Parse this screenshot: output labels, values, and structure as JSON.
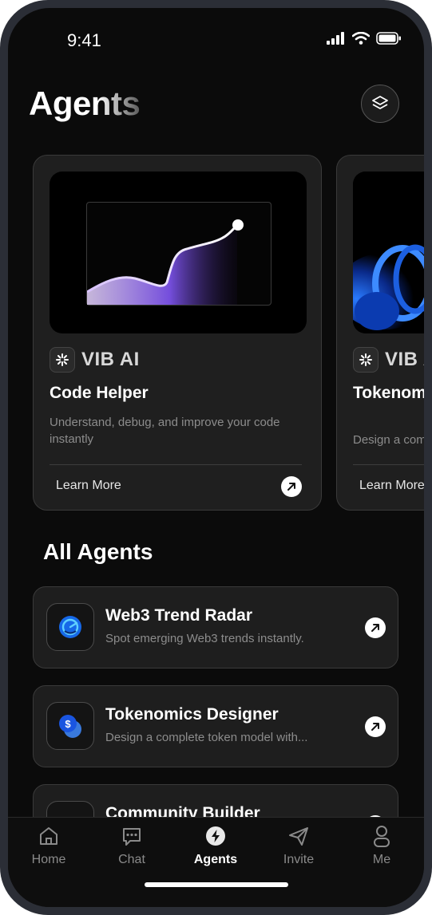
{
  "status": {
    "time": "9:41"
  },
  "header": {
    "title": "Agents",
    "layers_icon": "layers-icon"
  },
  "featured": [
    {
      "brand": "VIB AI",
      "title": "Code Helper",
      "description": "Understand, debug, and improve your code instantly",
      "action": "Learn More"
    },
    {
      "brand": "VIB AI",
      "title": "Tokenomics Designer",
      "description": "Design a complete token model with...",
      "action": "Learn More"
    }
  ],
  "section": {
    "title": "All Agents"
  },
  "agents": [
    {
      "name": "Web3 Trend Radar",
      "description": "Spot emerging Web3 trends instantly.",
      "icon": "radar-icon"
    },
    {
      "name": "Tokenomics Designer",
      "description": "Design a complete token model with...",
      "icon": "token-icon"
    },
    {
      "name": "Community Builder",
      "description": "",
      "icon": "community-icon"
    }
  ],
  "tabs": [
    {
      "label": "Home",
      "icon": "home-icon",
      "active": false
    },
    {
      "label": "Chat",
      "icon": "chat-icon",
      "active": false
    },
    {
      "label": "Agents",
      "icon": "bolt-icon",
      "active": true
    },
    {
      "label": "Invite",
      "icon": "send-icon",
      "active": false
    },
    {
      "label": "Me",
      "icon": "user-icon",
      "active": false
    }
  ],
  "colors": {
    "background": "#0b0b0b",
    "card": "#1f1f1f",
    "accent_purple": "#7b52e8",
    "accent_blue": "#1f6bff"
  }
}
